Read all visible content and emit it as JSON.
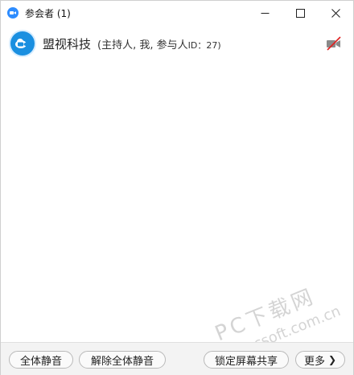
{
  "window": {
    "title": "参会者 (1)",
    "app_icon": "zoom-app-icon",
    "controls": {
      "minimize": "minimize-icon",
      "maximize": "maximize-icon",
      "close": "close-icon"
    }
  },
  "participant": {
    "name": "盟视科技",
    "role_prefix": "(主持人, 我, 参与人",
    "id_text": "ID：27)",
    "avatar_icon": "camera-cloud-icon",
    "video_status_icon": "video-off-icon"
  },
  "watermark": {
    "line1": "PC下载网",
    "line2": "pcsoft.com.cn"
  },
  "footer": {
    "mute_all_label": "全体静音",
    "unmute_all_label": "解除全体静音",
    "lock_share_label": "锁定屏幕共享",
    "more_label": "更多",
    "more_icon": "chevron-right-icon"
  },
  "colors": {
    "accent": "#2d8cff",
    "avatar_bg": "#1a8fe0",
    "video_off_slash": "#e02020"
  }
}
